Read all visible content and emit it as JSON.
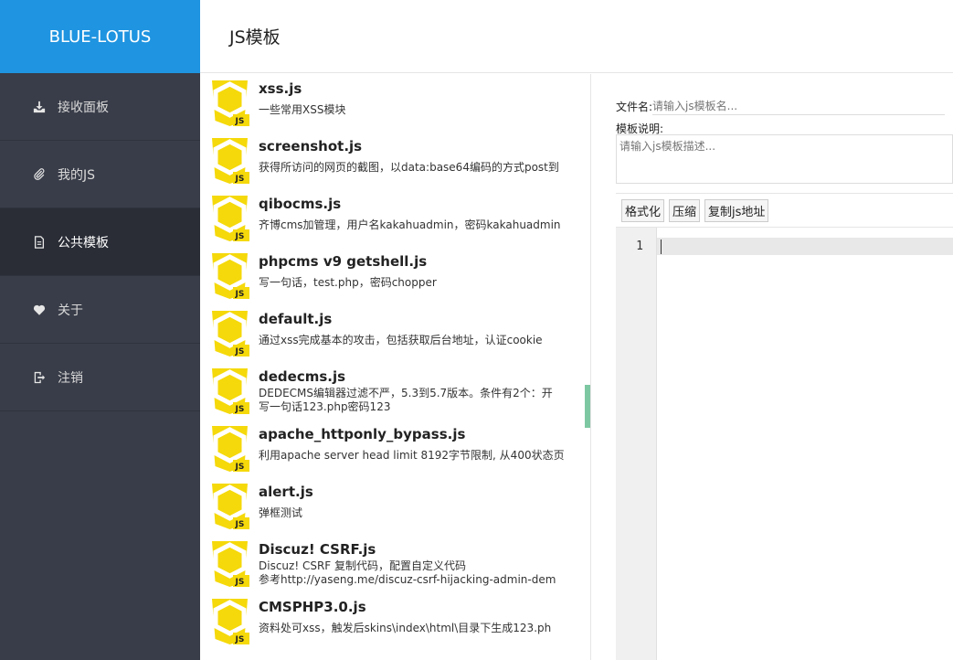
{
  "brand": "BLUE-LOTUS",
  "page_title": "JS模板",
  "sidebar": {
    "items": [
      {
        "label": "接收面板",
        "icon": "download-icon",
        "active": false
      },
      {
        "label": "我的JS",
        "icon": "paperclip-icon",
        "active": false
      },
      {
        "label": "公共模板",
        "icon": "file-icon",
        "active": true
      },
      {
        "label": "关于",
        "icon": "heart-icon",
        "active": false
      },
      {
        "label": "注销",
        "icon": "logout-icon",
        "active": false
      }
    ]
  },
  "templates": [
    {
      "name": "xss.js",
      "desc": [
        "一些常用XSS模块"
      ]
    },
    {
      "name": "screenshot.js",
      "desc": [
        "获得所访问的网页的截图，以data:base64编码的方式post到"
      ]
    },
    {
      "name": "qibocms.js",
      "desc": [
        "齐博cms加管理，用户名kakahuadmin，密码kakahuadmin"
      ]
    },
    {
      "name": "phpcms v9 getshell.js",
      "desc": [
        "写一句话，test.php，密码chopper"
      ]
    },
    {
      "name": "default.js",
      "desc": [
        "通过xss完成基本的攻击，包括获取后台地址，认证cookie"
      ]
    },
    {
      "name": "dedecms.js",
      "desc": [
        "DEDECMS编辑器过滤不严，5.3到5.7版本。条件有2个：开",
        "写一句话123.php密码123"
      ]
    },
    {
      "name": "apache_httponly_bypass.js",
      "desc": [
        "利用apache server head limit 8192字节限制, 从400状态页"
      ]
    },
    {
      "name": "alert.js",
      "desc": [
        "弹框测试"
      ]
    },
    {
      "name": "Discuz!  CSRF.js",
      "desc": [
        "Discuz!  CSRF  复制代码，配置自定义代码",
        "参考http://yaseng.me/discuz-csrf-hijacking-admin-dem"
      ]
    },
    {
      "name": "CMSPHP3.0.js",
      "desc": [
        "资料处可xss，触发后skins\\index\\html\\目录下生成123.ph"
      ]
    }
  ],
  "form": {
    "filename_label": "文件名:",
    "filename_placeholder": "请输入js模板名...",
    "desc_label": "模板说明:",
    "desc_placeholder": "请输入js模板描述..."
  },
  "toolbar": {
    "format_label": "格式化",
    "compress_label": "压缩",
    "copy_url_label": "复制js地址"
  },
  "editor": {
    "line_number": "1"
  },
  "colors": {
    "brand_bg": "#1f94e0",
    "sidebar_bg": "#393d49",
    "js_icon_yellow": "#f5d90a"
  }
}
